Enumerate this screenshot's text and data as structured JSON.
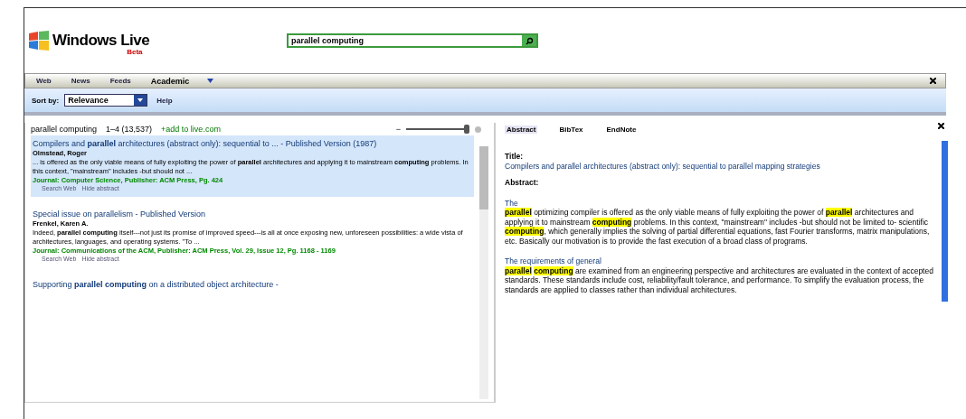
{
  "header": {
    "logo": "Windows Live",
    "logo_badge": "Beta",
    "search": {
      "value": "parallel computing"
    }
  },
  "tabs": [
    {
      "label": "Web",
      "selected": false
    },
    {
      "label": "News",
      "selected": false
    },
    {
      "label": "Feeds",
      "selected": false
    },
    {
      "label": "Academic",
      "selected": true
    }
  ],
  "toolbar": {
    "sort_label": "Sort by:",
    "sort_value": "Relevance",
    "help": "Help"
  },
  "results": {
    "query": "parallel computing",
    "range": "1–4 (13,537)",
    "add_link": "+add to live.com",
    "zoom_minus": "−",
    "zoom": {
      "level": 0.95
    },
    "items": [
      {
        "title": "Compilers and **parallel** architectures (abstract only): sequential to ... - Published Version (1987)",
        "authors": "Olmstead, Roger",
        "snippet": "... is offered as the only viable means of fully exploiting the power of **parallel** architectures and applying it to mainstream **computing** problems. In this context, \"mainstream\" includes -but should not ...",
        "journal": "Journal: Computer Science, Publisher: ACM Press, Pg. 424",
        "links": [
          "Search Web",
          "Hide abstract"
        ],
        "selected": true
      },
      {
        "title": "Special issue on parallelism - Published Version",
        "authors": "Frenkel, Karen A.",
        "snippet": "Indeed, **parallel computing** itself---not just its promise of improved speed---is all at once exposing new, unforeseen possibilities: a wide vista of architectures, languages, and operating systems. \"To ...",
        "journal": "Journal: Communications of the ACM, Publisher: ACM Press, Vol. 29, Issue 12, Pg. 1168 - 1169",
        "links": [
          "Search Web",
          "Hide abstract"
        ],
        "selected": false
      },
      {
        "title": "Supporting **parallel computing** on a distributed object architecture -",
        "selected": false
      }
    ]
  },
  "detail": {
    "tabs": [
      {
        "label": "Abstract",
        "selected": true
      },
      {
        "label": "BibTex",
        "selected": false
      },
      {
        "label": "EndNote",
        "selected": false
      }
    ],
    "title_label": "Title:",
    "title": "Compilers and parallel architectures (abstract only): sequential to parallel mapping strategies",
    "abstract_label": "Abstract:",
    "paragraphs": [
      {
        "lead": "The",
        "text": "**parallel** optimizing compiler is offered as the only viable means of fully exploiting the power of **parallel** architectures and applying it to mainstream **computing** problems. In this context, \"mainstream\" includes -but should not be limited to- scientific **computing**, which generally implies the solving of partial differential equations, fast Fourier transforms, matrix manipulations, etc. Basically our motivation is to provide the fast execution of a broad class of programs."
      },
      {
        "lead": "The requirements of general",
        "text": "**parallel** **computing** are examined from an engineering perspective and architectures are evaluated in the context of accepted standards. These standards include cost, reliability/fault tolerance, and performance. To simplify the evaluation process, the standards are applied to classes rather than individual architectures."
      }
    ]
  }
}
